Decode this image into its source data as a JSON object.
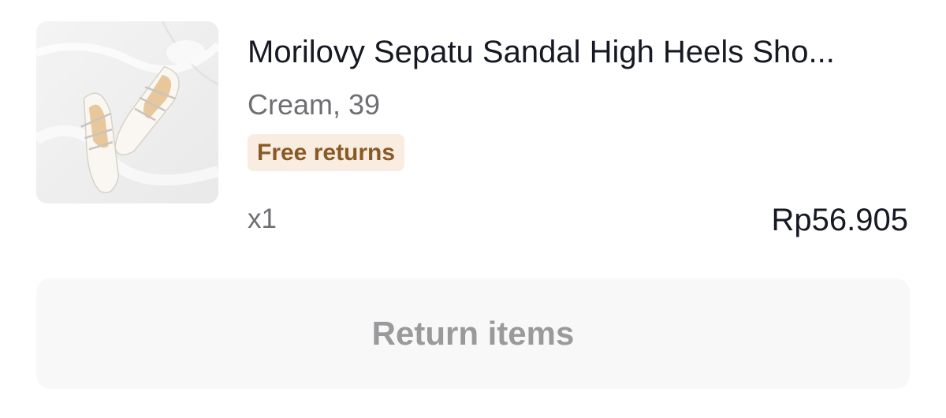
{
  "product": {
    "image": "shoe-product-photo",
    "title": "Morilovy Sepatu Sandal High Heels Sho...",
    "variant": "Cream, 39",
    "badge": "Free returns",
    "quantity": "x1",
    "price": "Rp56.905"
  },
  "actions": {
    "return_label": "Return items"
  },
  "colors": {
    "badge_bg": "#f9ece1",
    "badge_text": "#8a5a24",
    "button_bg": "#f8f8f8",
    "button_text": "#9a9a9c"
  }
}
